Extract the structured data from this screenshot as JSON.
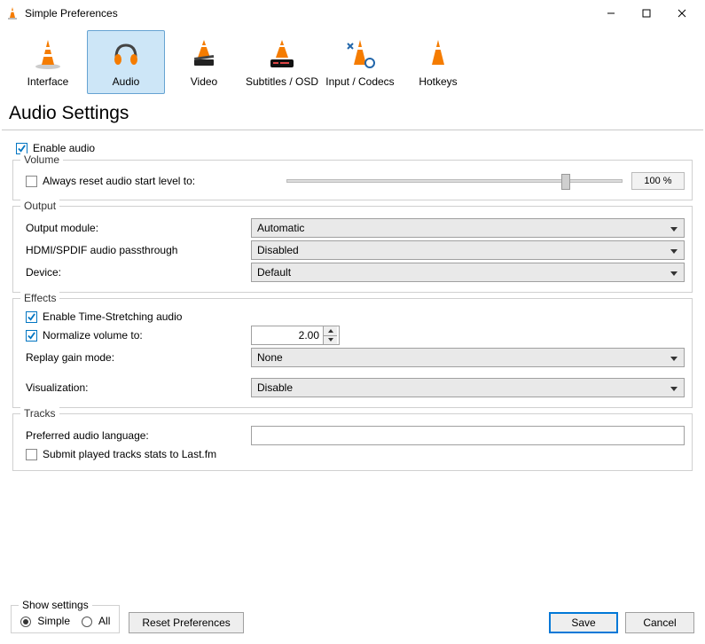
{
  "window": {
    "title": "Simple Preferences"
  },
  "tabs": {
    "interface": "Interface",
    "audio": "Audio",
    "video": "Video",
    "subtitles": "Subtitles / OSD",
    "input": "Input / Codecs",
    "hotkeys": "Hotkeys"
  },
  "page": {
    "heading": "Audio Settings"
  },
  "enable_audio": {
    "label": "Enable audio",
    "checked": true
  },
  "volume": {
    "legend": "Volume",
    "reset_label": "Always reset audio start level to:",
    "reset_checked": false,
    "slider_percent": 82,
    "readout": "100 %"
  },
  "output": {
    "legend": "Output",
    "module_label": "Output module:",
    "module_value": "Automatic",
    "passthrough_label": "HDMI/SPDIF audio passthrough",
    "passthrough_value": "Disabled",
    "device_label": "Device:",
    "device_value": "Default"
  },
  "effects": {
    "legend": "Effects",
    "timestretch_label": "Enable Time-Stretching audio",
    "timestretch_checked": true,
    "normalize_label": "Normalize volume to:",
    "normalize_checked": true,
    "normalize_value": "2.00",
    "replaygain_label": "Replay gain mode:",
    "replaygain_value": "None",
    "visualization_label": "Visualization:",
    "visualization_value": "Disable"
  },
  "tracks": {
    "legend": "Tracks",
    "preferred_label": "Preferred audio language:",
    "preferred_value": "",
    "lastfm_label": "Submit played tracks stats to Last.fm",
    "lastfm_checked": false
  },
  "footer": {
    "legend": "Show settings",
    "simple_label": "Simple",
    "all_label": "All",
    "simple_selected": true,
    "reset_label": "Reset Preferences",
    "save_label": "Save",
    "cancel_label": "Cancel"
  }
}
